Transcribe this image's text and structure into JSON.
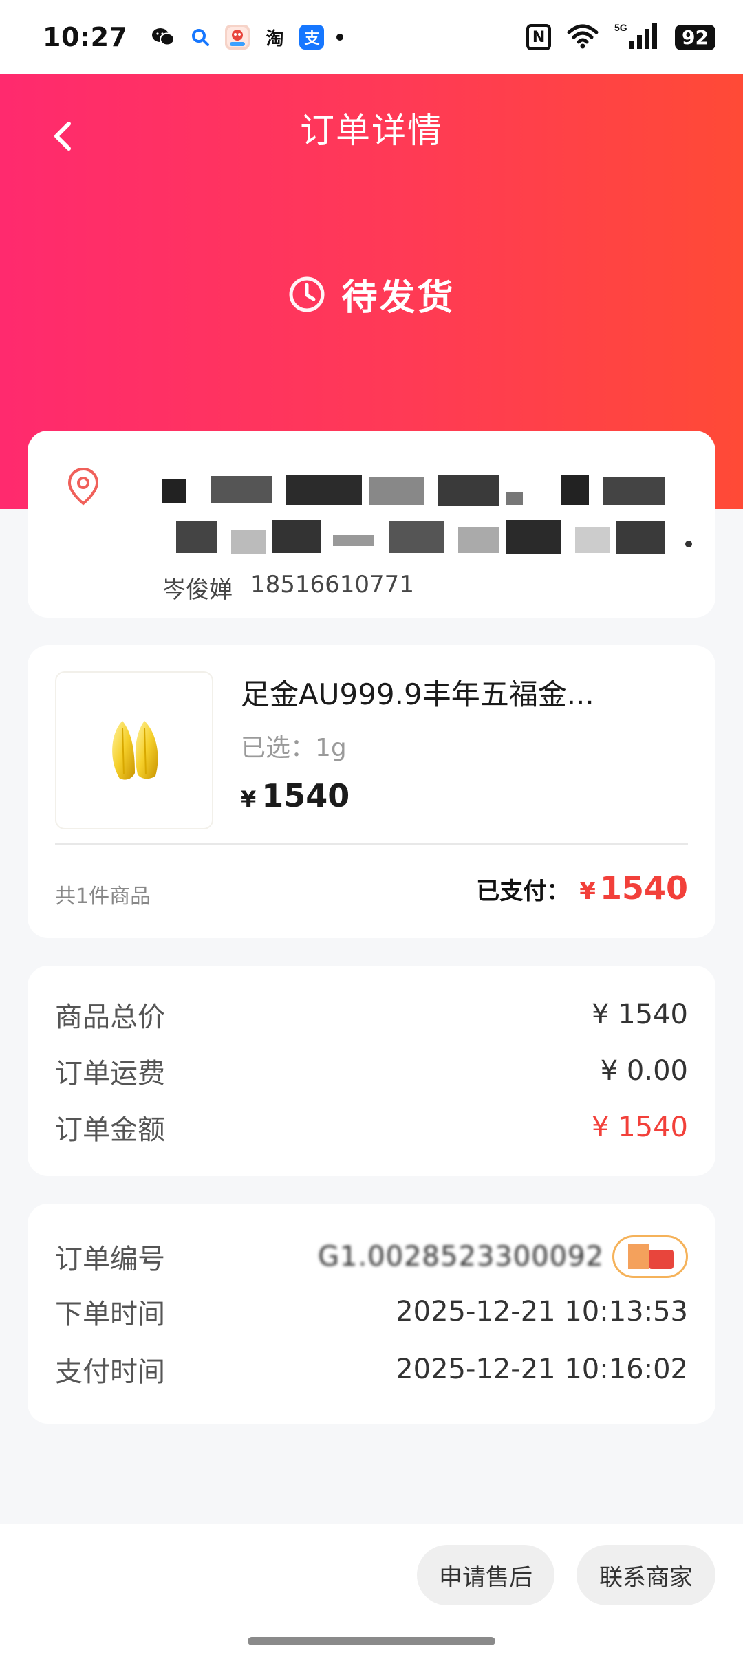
{
  "status_bar": {
    "time": "10:27",
    "apps": [
      {
        "icon": "wechat-icon",
        "label": "",
        "color": "#111111"
      },
      {
        "icon": "search-app-icon",
        "label": "Q",
        "color": "#1677ff"
      },
      {
        "icon": "game-app-icon",
        "label": "",
        "color": "#e8453c"
      },
      {
        "icon": "taobao-icon",
        "label": "淘",
        "color": "#111111"
      },
      {
        "icon": "alipay-icon",
        "label": "支",
        "color": "#1677ff"
      }
    ],
    "battery": "92",
    "network": "5G"
  },
  "nav": {
    "title": "订单详情"
  },
  "order_status": {
    "text": "待发货"
  },
  "address": {
    "name": "岑俊婵",
    "phone": "18516610771"
  },
  "goods": {
    "name": "足金AU999.9丰年五福金...",
    "spec": "已选：1g",
    "currency": "¥",
    "price": "1540",
    "count_text": "共1件商品",
    "paid_label": "已支付：",
    "paid_amount": "1540"
  },
  "fees": [
    {
      "label": "商品总价",
      "value": "¥ 1540",
      "highlight": false
    },
    {
      "label": "订单运费",
      "value": "¥ 0.00",
      "highlight": false
    },
    {
      "label": "订单金额",
      "value": "¥ 1540",
      "highlight": true
    }
  ],
  "order_info": [
    {
      "label": "订单编号",
      "value": "G1.0028523300092"
    },
    {
      "label": "下单时间",
      "value": "2025-12-21 10:13:53"
    },
    {
      "label": "支付时间",
      "value": "2025-12-21 10:16:02"
    }
  ],
  "actions": {
    "after_sale": "申请售后",
    "contact": "联系商家"
  },
  "colors": {
    "accent": "#f2403a",
    "gradient_start": "#ff2a6e",
    "gradient_end": "#ff4a36"
  }
}
